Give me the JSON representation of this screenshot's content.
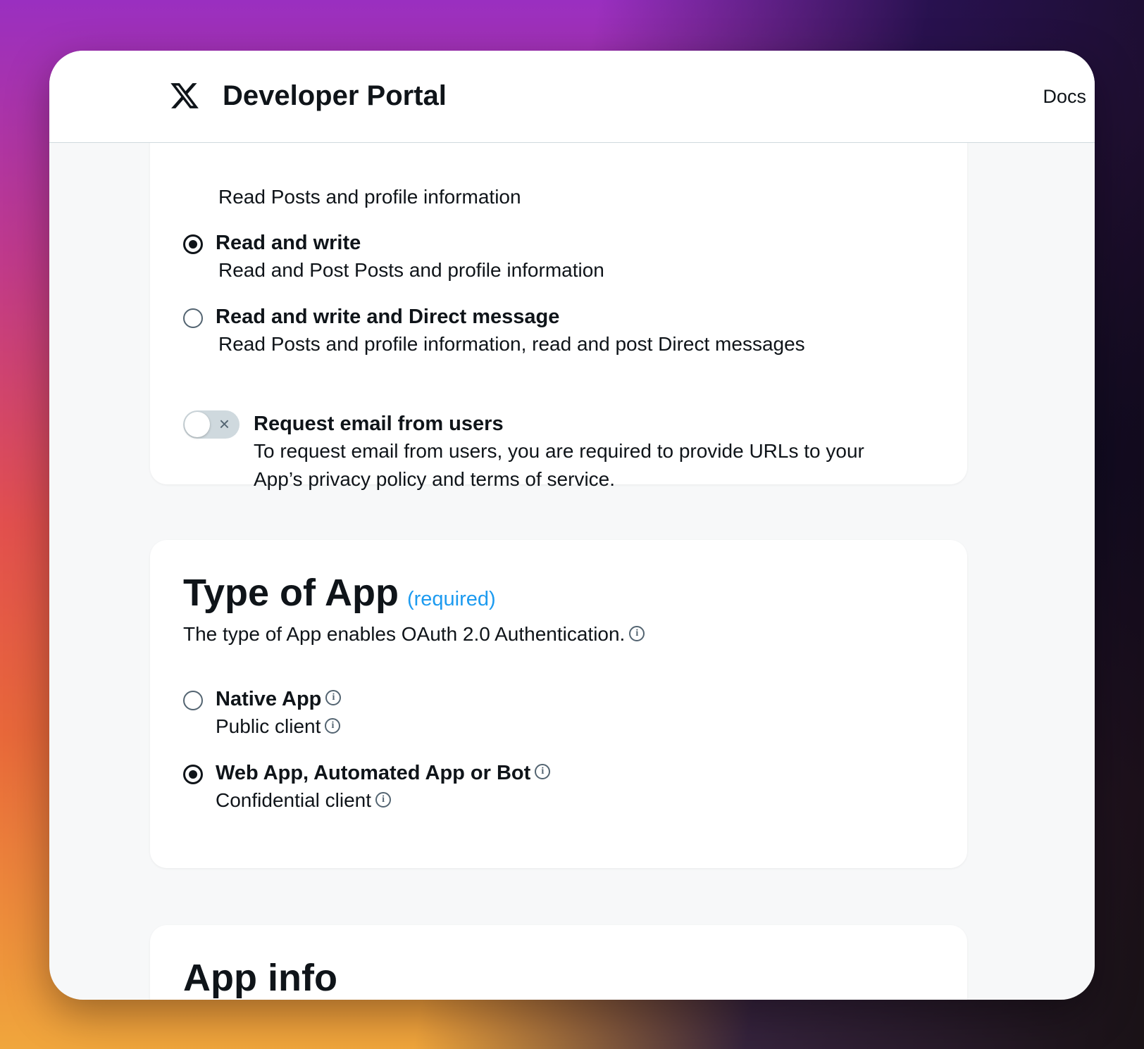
{
  "header": {
    "brand": "Developer Portal",
    "docs_label": "Docs",
    "logo_icon": "x-logo-icon"
  },
  "permissions": {
    "cut_off_desc": "Read Posts and profile information",
    "options": [
      {
        "title": "Read and write",
        "desc": "Read and Post Posts and profile information",
        "selected": true
      },
      {
        "title": "Read and write and Direct message",
        "desc": "Read Posts and profile information, read and post Direct messages",
        "selected": false
      }
    ],
    "email_toggle": {
      "title": "Request email from users",
      "desc_line1": "To request email from users, you are required to provide URLs to your",
      "desc_line2": "App’s privacy policy and terms of service.",
      "enabled": false
    }
  },
  "type_of_app": {
    "title": "Type of App",
    "required_label": "(required)",
    "subtitle": "The type of App enables OAuth 2.0 Authentication.",
    "options": [
      {
        "title": "Native App",
        "desc": "Public client",
        "selected": false
      },
      {
        "title": "Web App, Automated App or Bot",
        "desc": "Confidential client",
        "selected": true
      }
    ]
  },
  "app_info": {
    "title": "App info"
  },
  "colors": {
    "accent": "#1d9bf0",
    "text": "#0f1419",
    "muted": "#536471"
  }
}
